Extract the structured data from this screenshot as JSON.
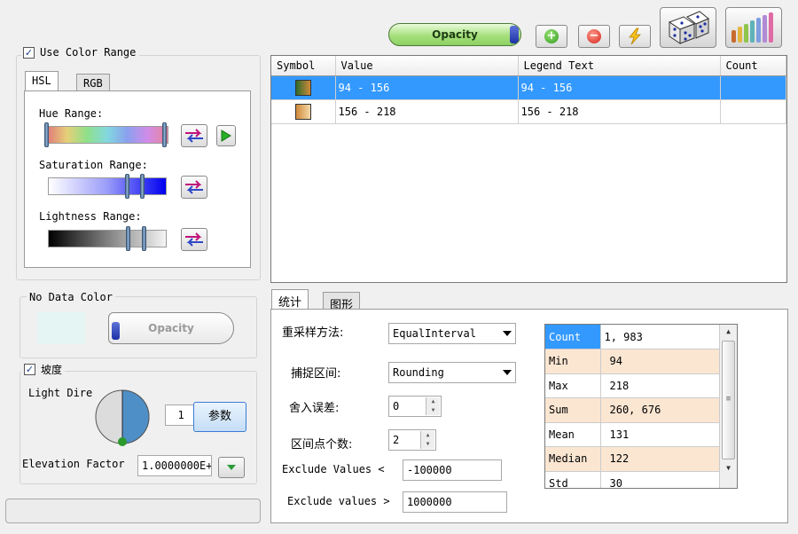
{
  "toolbar": {
    "opacity_label": "Opacity",
    "icons": [
      "add-icon",
      "remove-icon",
      "lightning-icon",
      "dice-icon",
      "color-bars-icon"
    ]
  },
  "color_range": {
    "use_label": "Use Color Range",
    "use_underline_char": "R",
    "checked": true,
    "tabs": [
      "HSL",
      "RGB"
    ],
    "active_tab": "HSL",
    "hue_label": "Hue Range:",
    "saturation_label": "Saturation Range:",
    "lightness_label": "Lightness Range:"
  },
  "no_data": {
    "title": "No Data Color",
    "opacity_label": "Opacity",
    "swatch_color": "#e5f5f3"
  },
  "slope": {
    "checkbox_label": "坡度",
    "checked": true,
    "light_dir_label": "Light Dire",
    "angle_value": "1 ",
    "params_button": "参数",
    "elevation_label": "Elevation Factor",
    "elevation_value": "1.0000000E+"
  },
  "legend_table": {
    "columns": [
      "Symbol",
      "Value",
      "Legend Text",
      "Count"
    ],
    "rows": [
      {
        "value": "94 - 156",
        "legend": "94 - 156",
        "count": "",
        "selected": true,
        "colors": [
          "#2e6a2a",
          "#d08a3a"
        ]
      },
      {
        "value": "156 - 218",
        "legend": "156 - 218",
        "count": "",
        "selected": false,
        "colors": [
          "#d08a3a",
          "#f4d9a8"
        ]
      }
    ]
  },
  "bottom_tabs": [
    "统计",
    "图形"
  ],
  "stats_form": {
    "resample_label": "重采样方法:",
    "resample_value": "EqualInterval",
    "snap_label": "捕捉区间:",
    "snap_value": "Rounding",
    "round_label": "舍入误差:",
    "round_value": "0",
    "points_label": "区间点个数:",
    "points_value": "2",
    "exclude_lt_label": "Exclude Values <",
    "exclude_lt_value": "-100000",
    "exclude_gt_label": "Exclude values >",
    "exclude_gt_value": "1000000"
  },
  "statistics": [
    {
      "key": "Count",
      "value": "1, 983"
    },
    {
      "key": "Min",
      "value": "94"
    },
    {
      "key": "Max",
      "value": "218"
    },
    {
      "key": "Sum",
      "value": "260, 676"
    },
    {
      "key": "Mean",
      "value": "131"
    },
    {
      "key": "Median",
      "value": "122"
    },
    {
      "key": "Std",
      "value": "30"
    }
  ]
}
